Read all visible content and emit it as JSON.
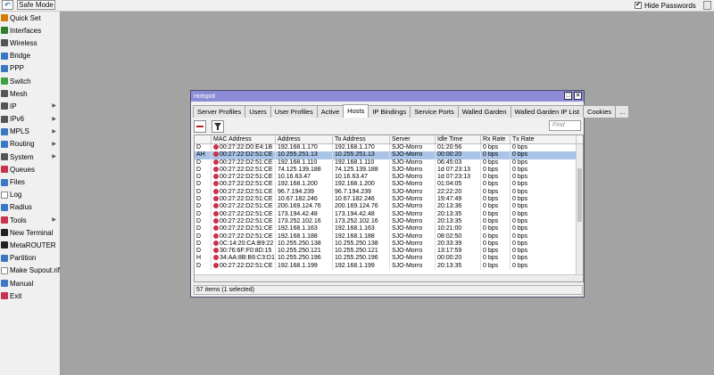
{
  "topbar": {
    "undo_glyph": "↶",
    "safe_mode_label": "Safe Mode",
    "hide_passwords_label": "Hide Passwords",
    "hide_passwords_checked": "✔"
  },
  "sidebar": {
    "items": [
      {
        "label": "Quick Set",
        "icon": "quick-set-icon",
        "color": "#d47c00",
        "arrow": ""
      },
      {
        "label": "Interfaces",
        "icon": "interfaces-icon",
        "color": "#2c7d2c",
        "arrow": ""
      },
      {
        "label": "Wireless",
        "icon": "wireless-icon",
        "color": "#555555",
        "arrow": ""
      },
      {
        "label": "Bridge",
        "icon": "bridge-icon",
        "color": "#3b78c4",
        "arrow": ""
      },
      {
        "label": "PPP",
        "icon": "ppp-icon",
        "color": "#3b78c4",
        "arrow": ""
      },
      {
        "label": "Switch",
        "icon": "switch-icon",
        "color": "#3fa03f",
        "arrow": ""
      },
      {
        "label": "Mesh",
        "icon": "mesh-icon",
        "color": "#555555",
        "arrow": ""
      },
      {
        "label": "IP",
        "icon": "ip-icon",
        "color": "#555555",
        "arrow": "▶"
      },
      {
        "label": "IPv6",
        "icon": "ipv6-icon",
        "color": "#555555",
        "arrow": "▶"
      },
      {
        "label": "MPLS",
        "icon": "mpls-icon",
        "color": "#3b78c4",
        "arrow": "▶"
      },
      {
        "label": "Routing",
        "icon": "routing-icon",
        "color": "#3b78c4",
        "arrow": "▶"
      },
      {
        "label": "System",
        "icon": "system-icon",
        "color": "#555555",
        "arrow": "▶"
      },
      {
        "label": "Queues",
        "icon": "queues-icon",
        "color": "#c8324b",
        "arrow": ""
      },
      {
        "label": "Files",
        "icon": "files-icon",
        "color": "#3b78c4",
        "arrow": ""
      },
      {
        "label": "Log",
        "icon": "log-icon",
        "color": "#ffffff",
        "arrow": ""
      },
      {
        "label": "Radius",
        "icon": "radius-icon",
        "color": "#3b78c4",
        "arrow": ""
      },
      {
        "label": "Tools",
        "icon": "tools-icon",
        "color": "#c8324b",
        "arrow": "▶"
      },
      {
        "label": "New Terminal",
        "icon": "terminal-icon",
        "color": "#222222",
        "arrow": ""
      },
      {
        "label": "MetaROUTER",
        "icon": "metarouter-icon",
        "color": "#222222",
        "arrow": ""
      },
      {
        "label": "Partition",
        "icon": "partition-icon",
        "color": "#3b78c4",
        "arrow": ""
      },
      {
        "label": "Make Supout.rif",
        "icon": "supout-icon",
        "color": "#ffffff",
        "arrow": ""
      },
      {
        "label": "Manual",
        "icon": "manual-icon",
        "color": "#3b78c4",
        "arrow": ""
      },
      {
        "label": "Exit",
        "icon": "exit-icon",
        "color": "#c8324b",
        "arrow": ""
      }
    ]
  },
  "window": {
    "title": "Hotspot",
    "restore_glyph": "□",
    "close_glyph": "✕",
    "tabs": [
      {
        "label": "Server Profiles"
      },
      {
        "label": "Users"
      },
      {
        "label": "User Profiles"
      },
      {
        "label": "Active"
      },
      {
        "label": "Hosts",
        "active": true
      },
      {
        "label": "IP Bindings"
      },
      {
        "label": "Service Ports"
      },
      {
        "label": "Walled Garden"
      },
      {
        "label": "Walled Garden IP List"
      },
      {
        "label": "Cookies"
      },
      {
        "label": "..."
      }
    ],
    "find_placeholder": "Find",
    "columns": [
      "",
      "MAC Address",
      "Address",
      "To Address",
      "Server",
      "Idle Time",
      "Rx Rate",
      "Tx Rate"
    ],
    "rows": [
      [
        "D",
        "00:27:22:D0:E4:1B",
        "192.168.1.170",
        "192.168.1.170",
        "SJO-Morro",
        "01:20:56",
        "0 bps",
        "0 bps"
      ],
      [
        "AH",
        "00:27:22:D2:51:CE",
        "10.255.251.13",
        "10.255.251.13",
        "SJO-Morro",
        "00:00:20",
        "0 bps",
        "0 bps"
      ],
      [
        "D",
        "00:27:22:D2:51:CE",
        "192.168.1.110",
        "192.168.1.110",
        "SJO-Morro",
        "06:45:03",
        "0 bps",
        "0 bps"
      ],
      [
        "D",
        "00:27:22:D2:51:CE",
        "74.125.139.188",
        "74.125.139.188",
        "SJO-Morro",
        "1d 07:23:13",
        "0 bps",
        "0 bps"
      ],
      [
        "D",
        "00:27:22:D2:51:CE",
        "10.16.63.47",
        "10.16.63.47",
        "SJO-Morro",
        "1d 07:23:13",
        "0 bps",
        "0 bps"
      ],
      [
        "D",
        "00:27:22:D2:51:CE",
        "192.168.1.200",
        "192.168.1.200",
        "SJO-Morro",
        "01:04:05",
        "0 bps",
        "0 bps"
      ],
      [
        "D",
        "00:27:22:D2:51:CE",
        "96.7.194.239",
        "96.7.194.239",
        "SJO-Morro",
        "22:22:20",
        "0 bps",
        "0 bps"
      ],
      [
        "D",
        "00:27:22:D2:51:CE",
        "10.67.182.246",
        "10.67.182.246",
        "SJO-Morro",
        "19:47:49",
        "0 bps",
        "0 bps"
      ],
      [
        "D",
        "00:27:22:D2:51:CE",
        "200.169.124.76",
        "200.169.124.76",
        "SJO-Morro",
        "20:13:36",
        "0 bps",
        "0 bps"
      ],
      [
        "D",
        "00:27:22:D2:51:CE",
        "173.194.42.48",
        "173.194.42.48",
        "SJO-Morro",
        "20:13:35",
        "0 bps",
        "0 bps"
      ],
      [
        "D",
        "00:27:22:D2:51:CE",
        "173.252.102.16",
        "173.252.102.16",
        "SJO-Morro",
        "20:13:35",
        "0 bps",
        "0 bps"
      ],
      [
        "D",
        "00:27:22:D2:51:CE",
        "192.168.1.163",
        "192.168.1.163",
        "SJO-Morro",
        "10:21:00",
        "0 bps",
        "0 bps"
      ],
      [
        "D",
        "00:27:22:D2:51:CE",
        "192.168.1.188",
        "192.168.1.188",
        "SJO-Morro",
        "08:02:50",
        "0 bps",
        "0 bps"
      ],
      [
        "D",
        "0C:14:20:CA:B9:22",
        "10.255.250.138",
        "10.255.250.138",
        "SJO-Morro",
        "20:33:39",
        "0 bps",
        "0 bps"
      ],
      [
        "D",
        "30:76:6F:F0:8D:15",
        "10.255.250.121",
        "10.255.250.121",
        "SJO-Morro",
        "13:17:59",
        "0 bps",
        "0 bps"
      ],
      [
        "H",
        "34:AA:8B:B6:C3:D1",
        "10.255.250.196",
        "10.255.250.196",
        "SJO-Morro",
        "00:00:20",
        "0 bps",
        "0 bps"
      ],
      [
        "D",
        "00:27:22:D2:51:CE",
        "192.168.1.199",
        "192.168.1.199",
        "SJO-Morro",
        "20:13:35",
        "0 bps",
        "0 bps"
      ]
    ],
    "selected_row": 1,
    "status": "57 items (1 selected)"
  }
}
